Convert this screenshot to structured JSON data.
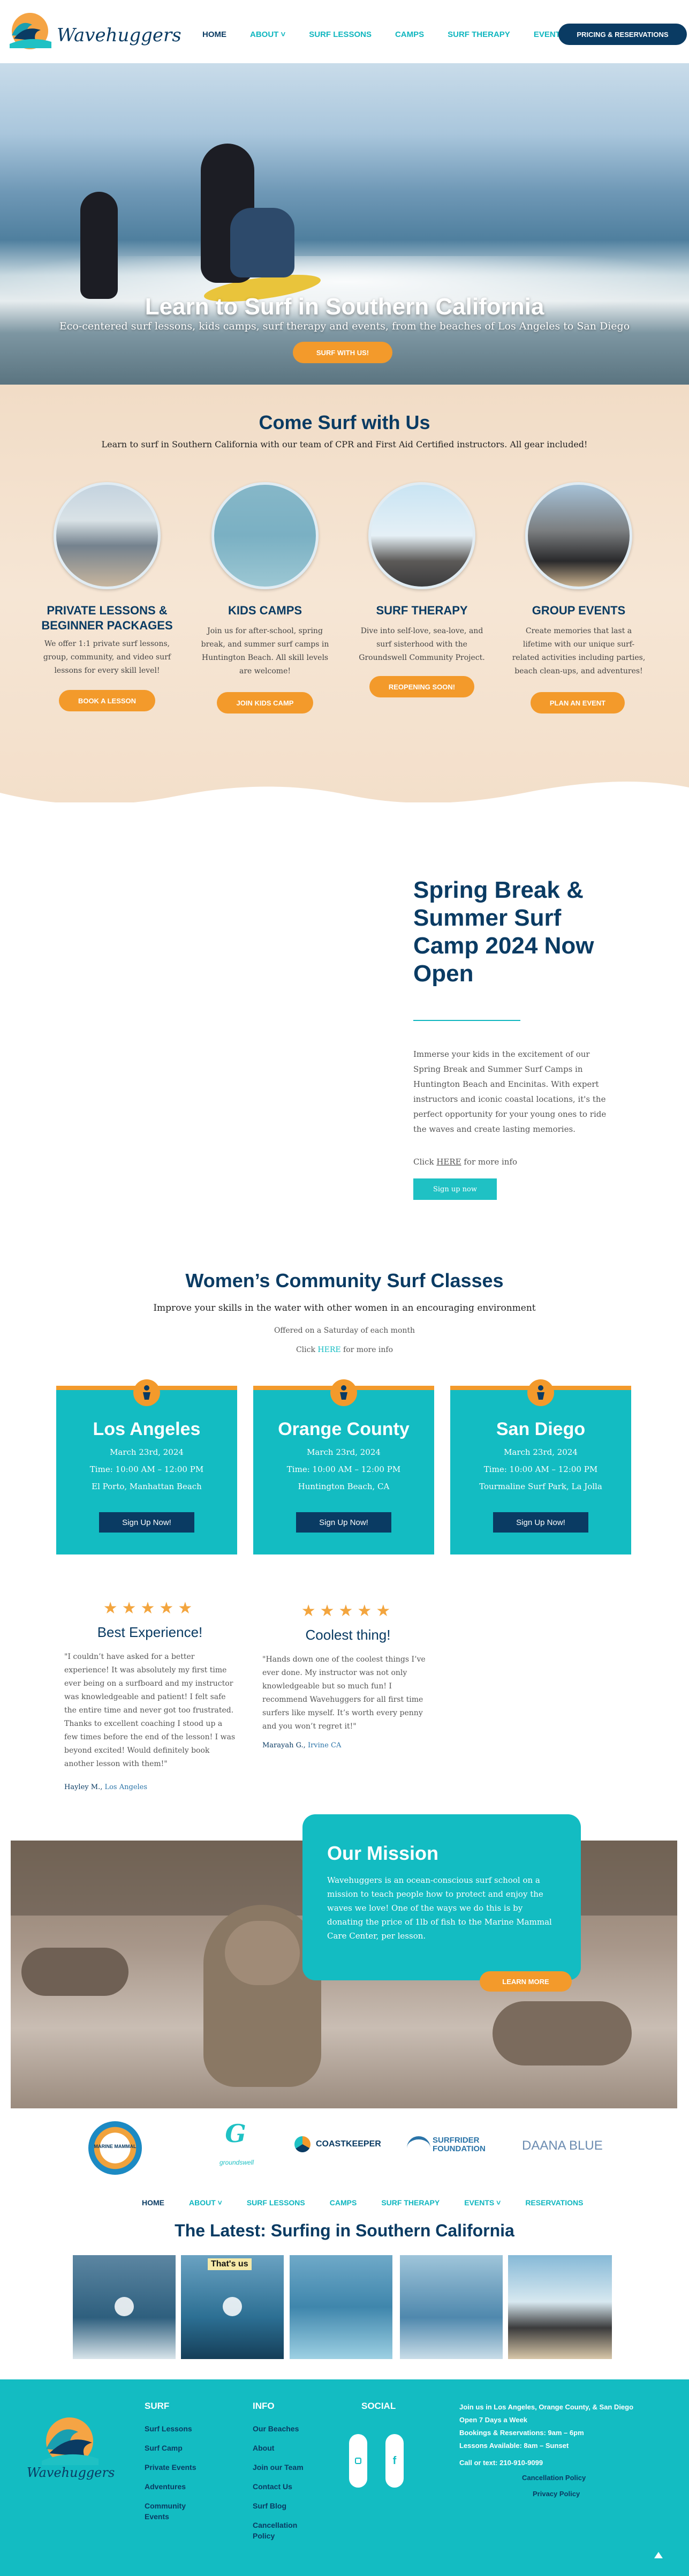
{
  "brand": {
    "name": "Wavehuggers"
  },
  "nav": {
    "items": [
      {
        "label": "HOME"
      },
      {
        "label": "ABOUT ˅"
      },
      {
        "label": "SURF LESSONS"
      },
      {
        "label": "CAMPS"
      },
      {
        "label": "SURF THERAPY"
      },
      {
        "label": "EVENTS ˅"
      }
    ],
    "cta": "PRICING & RESERVATIONS"
  },
  "hero": {
    "title": "Learn to Surf in Southern California",
    "subtitle": "Eco-centered surf lessons, kids camps, surf therapy and events, from the beaches of Los Angeles to San Diego",
    "button": "SURF WITH US!"
  },
  "intro": {
    "title": "Come Surf with Us",
    "subtitle": "Learn to surf in Southern California with our team of CPR and First Aid Certified instructors. All gear included!"
  },
  "features": [
    {
      "title": "PRIVATE LESSONS & BEGINNER PACKAGES",
      "text": "We offer 1:1 private surf lessons, group, community, and video surf lessons for every skill level!",
      "button": "BOOK A LESSON"
    },
    {
      "title": "KIDS CAMPS",
      "text": "Join us for after-school, spring break, and summer surf camps in Huntington Beach. All skill levels are welcome!",
      "button": "JOIN KIDS CAMP"
    },
    {
      "title": "SURF THERAPY",
      "text": "Dive into self-love, sea-love, and surf sisterhood with the Groundswell Community Project.",
      "button": "REOPENING SOON!"
    },
    {
      "title": "GROUP EVENTS",
      "text": "Create memories that last a lifetime with our unique surf-related activities including parties, beach clean-ups, and adventures!",
      "button": "PLAN AN EVENT"
    }
  ],
  "spring": {
    "title": "Spring Break & Summer Surf Camp 2024 Now Open",
    "text": "Immerse your kids in the excitement of our Spring Break and Summer Surf Camps in Huntington Beach and Encinitas. With expert instructors and iconic coastal locations, it's the perfect opportunity for your young ones to ride the waves and create lasting memories.",
    "click_prefix": "Click ",
    "click_link": "HERE",
    "click_suffix": " for more info",
    "button": "Sign up now"
  },
  "women": {
    "title": "Women’s Community Surf Classes",
    "subtitle": "Improve your skills in the water with other women in an encouraging environment",
    "offered": "Offered on a Saturday of each month",
    "click_prefix": "Click ",
    "click_link": "HERE",
    "click_suffix": " for more info",
    "cards": [
      {
        "city": "Los Angeles",
        "date": "March 23rd, 2024",
        "time": "Time: 10:00 AM – 12:00 PM",
        "place": "El Porto, Manhattan  Beach",
        "button": "Sign Up Now!"
      },
      {
        "city": "Orange County",
        "date": "March 23rd, 2024",
        "time": "Time: 10:00 AM – 12:00 PM",
        "place": "Huntington Beach, CA",
        "button": "Sign Up Now!"
      },
      {
        "city": "San Diego",
        "date": "March 23rd, 2024",
        "time": "Time: 10:00 AM – 12:00 PM",
        "place": "Tourmaline Surf Park, La Jolla",
        "button": "Sign Up Now!"
      }
    ]
  },
  "testimonials": [
    {
      "stars": "★★★★★",
      "title": "Best Experience!",
      "text": "\"I couldn’t have asked for a better experience! It was absolutely my first time ever being on a surfboard and my instructor was knowledgeable and patient! I felt safe the entire time and never got too frustrated. Thanks to excellent coaching I stood up a few times before the end of the lesson! I was beyond excited! Would definitely book another lesson with them!\"",
      "name": "Hayley M., ",
      "location": "Los Angeles"
    },
    {
      "stars": "★★★★★",
      "title": "Coolest thing!",
      "text": "\"Hands down one of the coolest things I’ve ever done. My instructor was not only knowledgeable but so much fun! I recommend Wavehuggers for all first time surfers like myself. It’s worth every penny and you won’t regret it!\"",
      "name": "Marayah G., ",
      "location": "Irvine CA"
    }
  ],
  "mission": {
    "title": "Our Mission",
    "text": "Wavehuggers is an ocean-conscious surf school on a mission to teach people how to protect and enjoy the waves we love! One of the ways we do this is by donating the price of 1lb of fish to the Marine Mammal Care Center, per lesson.",
    "button": "LEARN MORE"
  },
  "partners": [
    {
      "name": "MARINE MAMMAL"
    },
    {
      "name": "groundswell"
    },
    {
      "name": "COASTKEEPER"
    },
    {
      "name": "SURFRIDER FOUNDATION"
    },
    {
      "name": "DAANA BLUE"
    }
  ],
  "nav2": {
    "items": [
      {
        "label": "HOME"
      },
      {
        "label": "ABOUT ˅"
      },
      {
        "label": "SURF LESSONS"
      },
      {
        "label": "CAMPS"
      },
      {
        "label": "SURF THERAPY"
      },
      {
        "label": "EVENTS ˅"
      },
      {
        "label": "RESERVATIONS"
      }
    ]
  },
  "latest": {
    "title": "The Latest: Surfing in Southern California",
    "thumb2_caption": "That's us"
  },
  "footer": {
    "logo_text": "Wavehuggers",
    "surf": {
      "title": "SURF",
      "links": [
        "Surf Lessons",
        "Surf Camp",
        "Private Events",
        "Adventures",
        "Community Events"
      ]
    },
    "info": {
      "title": "INFO",
      "links": [
        "Our Beaches",
        "About",
        "Join our Team",
        "Contact Us",
        "Surf Blog",
        "Cancellation Policy"
      ]
    },
    "social": {
      "title": "SOCIAL"
    },
    "contact": [
      "Join us in Los Angeles, Orange County, & San Diego",
      "Open 7 Days a Week",
      "Bookings & Reservations: 9am – 6pm",
      "Lessons Available: 8am – Sunset",
      "Call or text: 210-910-9099"
    ],
    "policy1": "Cancellation Policy",
    "policy2": "Privacy Policy"
  },
  "colors": {
    "navy": "#0a3b63",
    "teal": "#13bcc2",
    "orange": "#f39a2b"
  }
}
